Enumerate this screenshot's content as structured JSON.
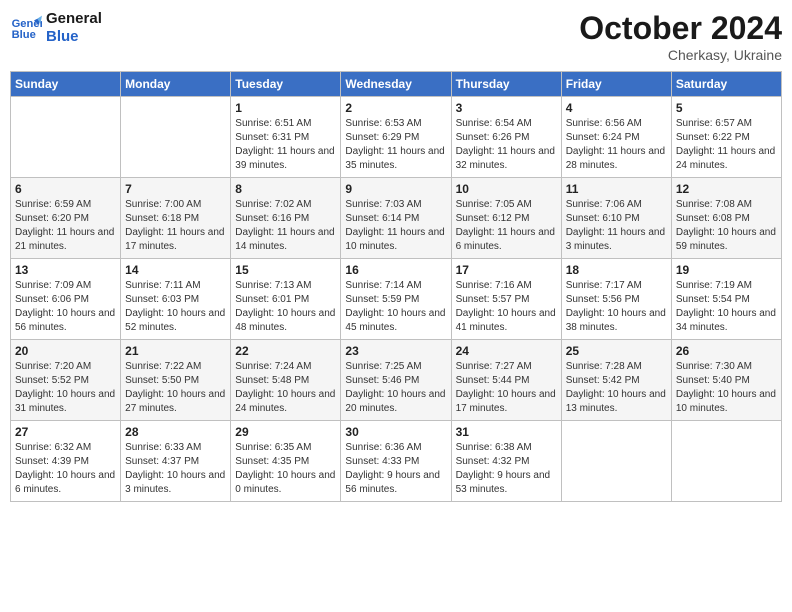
{
  "header": {
    "logo": {
      "line1": "General",
      "line2": "Blue"
    },
    "title": "October 2024",
    "subtitle": "Cherkasy, Ukraine"
  },
  "weekdays": [
    "Sunday",
    "Monday",
    "Tuesday",
    "Wednesday",
    "Thursday",
    "Friday",
    "Saturday"
  ],
  "weeks": [
    [
      null,
      null,
      {
        "day": 1,
        "sunrise": "6:51 AM",
        "sunset": "6:31 PM",
        "daylight": "11 hours and 39 minutes."
      },
      {
        "day": 2,
        "sunrise": "6:53 AM",
        "sunset": "6:29 PM",
        "daylight": "11 hours and 35 minutes."
      },
      {
        "day": 3,
        "sunrise": "6:54 AM",
        "sunset": "6:26 PM",
        "daylight": "11 hours and 32 minutes."
      },
      {
        "day": 4,
        "sunrise": "6:56 AM",
        "sunset": "6:24 PM",
        "daylight": "11 hours and 28 minutes."
      },
      {
        "day": 5,
        "sunrise": "6:57 AM",
        "sunset": "6:22 PM",
        "daylight": "11 hours and 24 minutes."
      }
    ],
    [
      {
        "day": 6,
        "sunrise": "6:59 AM",
        "sunset": "6:20 PM",
        "daylight": "11 hours and 21 minutes."
      },
      {
        "day": 7,
        "sunrise": "7:00 AM",
        "sunset": "6:18 PM",
        "daylight": "11 hours and 17 minutes."
      },
      {
        "day": 8,
        "sunrise": "7:02 AM",
        "sunset": "6:16 PM",
        "daylight": "11 hours and 14 minutes."
      },
      {
        "day": 9,
        "sunrise": "7:03 AM",
        "sunset": "6:14 PM",
        "daylight": "11 hours and 10 minutes."
      },
      {
        "day": 10,
        "sunrise": "7:05 AM",
        "sunset": "6:12 PM",
        "daylight": "11 hours and 6 minutes."
      },
      {
        "day": 11,
        "sunrise": "7:06 AM",
        "sunset": "6:10 PM",
        "daylight": "11 hours and 3 minutes."
      },
      {
        "day": 12,
        "sunrise": "7:08 AM",
        "sunset": "6:08 PM",
        "daylight": "10 hours and 59 minutes."
      }
    ],
    [
      {
        "day": 13,
        "sunrise": "7:09 AM",
        "sunset": "6:06 PM",
        "daylight": "10 hours and 56 minutes."
      },
      {
        "day": 14,
        "sunrise": "7:11 AM",
        "sunset": "6:03 PM",
        "daylight": "10 hours and 52 minutes."
      },
      {
        "day": 15,
        "sunrise": "7:13 AM",
        "sunset": "6:01 PM",
        "daylight": "10 hours and 48 minutes."
      },
      {
        "day": 16,
        "sunrise": "7:14 AM",
        "sunset": "5:59 PM",
        "daylight": "10 hours and 45 minutes."
      },
      {
        "day": 17,
        "sunrise": "7:16 AM",
        "sunset": "5:57 PM",
        "daylight": "10 hours and 41 minutes."
      },
      {
        "day": 18,
        "sunrise": "7:17 AM",
        "sunset": "5:56 PM",
        "daylight": "10 hours and 38 minutes."
      },
      {
        "day": 19,
        "sunrise": "7:19 AM",
        "sunset": "5:54 PM",
        "daylight": "10 hours and 34 minutes."
      }
    ],
    [
      {
        "day": 20,
        "sunrise": "7:20 AM",
        "sunset": "5:52 PM",
        "daylight": "10 hours and 31 minutes."
      },
      {
        "day": 21,
        "sunrise": "7:22 AM",
        "sunset": "5:50 PM",
        "daylight": "10 hours and 27 minutes."
      },
      {
        "day": 22,
        "sunrise": "7:24 AM",
        "sunset": "5:48 PM",
        "daylight": "10 hours and 24 minutes."
      },
      {
        "day": 23,
        "sunrise": "7:25 AM",
        "sunset": "5:46 PM",
        "daylight": "10 hours and 20 minutes."
      },
      {
        "day": 24,
        "sunrise": "7:27 AM",
        "sunset": "5:44 PM",
        "daylight": "10 hours and 17 minutes."
      },
      {
        "day": 25,
        "sunrise": "7:28 AM",
        "sunset": "5:42 PM",
        "daylight": "10 hours and 13 minutes."
      },
      {
        "day": 26,
        "sunrise": "7:30 AM",
        "sunset": "5:40 PM",
        "daylight": "10 hours and 10 minutes."
      }
    ],
    [
      {
        "day": 27,
        "sunrise": "6:32 AM",
        "sunset": "4:39 PM",
        "daylight": "10 hours and 6 minutes."
      },
      {
        "day": 28,
        "sunrise": "6:33 AM",
        "sunset": "4:37 PM",
        "daylight": "10 hours and 3 minutes."
      },
      {
        "day": 29,
        "sunrise": "6:35 AM",
        "sunset": "4:35 PM",
        "daylight": "10 hours and 0 minutes."
      },
      {
        "day": 30,
        "sunrise": "6:36 AM",
        "sunset": "4:33 PM",
        "daylight": "9 hours and 56 minutes."
      },
      {
        "day": 31,
        "sunrise": "6:38 AM",
        "sunset": "4:32 PM",
        "daylight": "9 hours and 53 minutes."
      },
      null,
      null
    ]
  ]
}
